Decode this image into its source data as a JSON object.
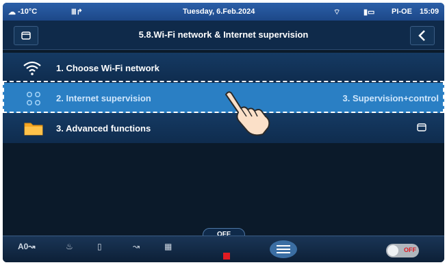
{
  "status": {
    "temperature": "-10°C",
    "date": "Tuesday, 6.Feb.2024",
    "weekday_mode": "PI-OE",
    "time": "15:09"
  },
  "header": {
    "title": "5.8.Wi-Fi network & Internet supervision"
  },
  "menu": [
    {
      "label": "1. Choose Wi-Fi network",
      "value": ""
    },
    {
      "label": "2. Internet supervision",
      "value": "3. Supervision+control"
    },
    {
      "label": "3. Advanced functions",
      "value": ""
    }
  ],
  "bottom": {
    "off_label": "OFF",
    "toggle_label": "OFF"
  },
  "colors": {
    "selected_row": "#2a7fc4",
    "stop_button": "#e11b22",
    "accent": "#2b5fa8"
  }
}
